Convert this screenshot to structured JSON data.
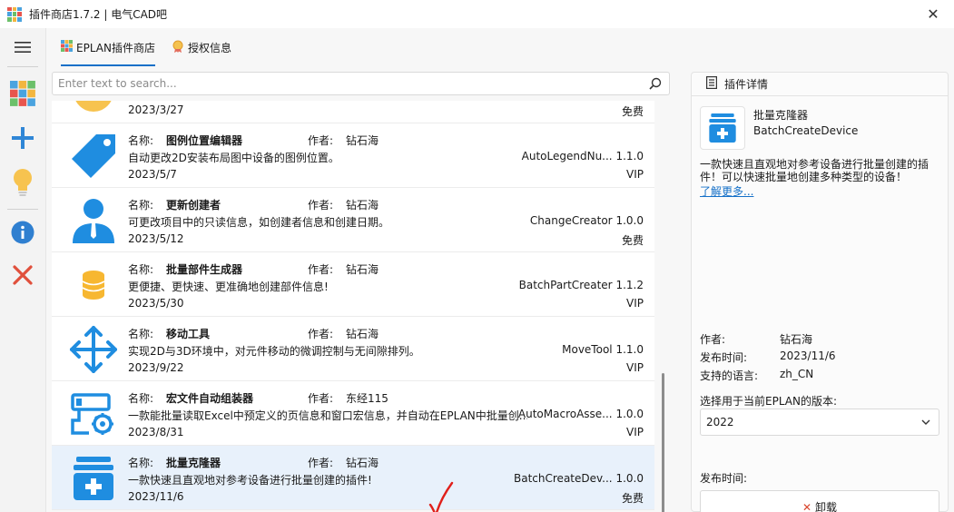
{
  "window": {
    "title": "插件商店1.7.2 | 电气CAD吧",
    "close_glyph": "✕",
    "icon_colors": [
      "#e8554e",
      "#f3b63f",
      "#4aa3df",
      "#4aa3df",
      "#6cc06a",
      "#e8554e",
      "#6cc06a",
      "#f3b63f",
      "#4aa3df"
    ]
  },
  "rail": {
    "items": [
      {
        "icon": "menu-icon"
      },
      {
        "icon": "store-icon"
      },
      {
        "icon": "add-icon"
      },
      {
        "icon": "lightbulb-icon"
      },
      {
        "icon": "info-icon"
      },
      {
        "icon": "close-icon"
      }
    ]
  },
  "tabs": [
    {
      "label": "EPLAN插件商店",
      "icon": "store-icon",
      "active": true
    },
    {
      "label": "授权信息",
      "icon": "license-icon",
      "active": false
    }
  ],
  "search": {
    "placeholder": "Enter text to search..."
  },
  "list": {
    "name_label": "名称:",
    "author_label": "作者:",
    "partial_row": {
      "date": "2023/3/27",
      "price": "免费"
    },
    "rows": [
      {
        "name": "图例位置编辑器",
        "author": "钻石海",
        "desc": "自动更改2D安装布局图中设备的图例位置。",
        "date": "2023/5/7",
        "cmd": "AutoLegendNu...",
        "version": "1.1.0",
        "price": "VIP",
        "icon": "tag-icon",
        "selected": false
      },
      {
        "name": "更新创建者",
        "author": "钻石海",
        "desc": "可更改项目中的只读信息，如创建者信息和创建日期。",
        "date": "2023/5/12",
        "cmd": "ChangeCreator",
        "version": "1.0.0",
        "price": "免费",
        "icon": "user-icon",
        "selected": false
      },
      {
        "name": "批量部件生成器",
        "author": "钻石海",
        "desc": "更便捷、更快速、更准确地创建部件信息!",
        "date": "2023/5/30",
        "cmd": "BatchPartCreater",
        "version": "1.1.2",
        "price": "VIP",
        "icon": "coins-icon",
        "selected": false
      },
      {
        "name": "移动工具",
        "author": "钻石海",
        "desc": "实现2D与3D环境中，对元件移动的微调控制与无间隙排列。",
        "date": "2023/9/22",
        "cmd": "MoveTool",
        "version": "1.1.0",
        "price": "VIP",
        "icon": "move-icon",
        "selected": false
      },
      {
        "name": "宏文件自动组装器",
        "author": "东经115",
        "desc": "一款能批量读取Excel中预定义的页信息和窗口宏信息，并自动在EPLAN中批量创...",
        "date": "2023/8/31",
        "cmd": "AutoMacroAsse...",
        "version": "1.0.0",
        "price": "VIP",
        "icon": "macro-gear-icon",
        "selected": false
      },
      {
        "name": "批量克隆器",
        "author": "钻石海",
        "desc": "一款快速且直观地对参考设备进行批量创建的插件!",
        "date": "2023/11/6",
        "cmd": "BatchCreateDev...",
        "version": "1.0.0",
        "price": "免费",
        "icon": "clone-icon",
        "selected": true
      }
    ]
  },
  "detail": {
    "header": "插件详情",
    "name": "批量克隆器",
    "command": "BatchCreateDevice",
    "description": "一款快速且直观地对参考设备进行批量创建的插件！可以快速批量地创建多种类型的设备！",
    "more_link": "了解更多...",
    "author_label": "作者:",
    "author": "钻石海",
    "release_time_label": "发布时间:",
    "release_time": "2023/11/6",
    "language_label": "支持的语言:",
    "language": "zh_CN",
    "version_select_label": "选择用于当前EPLAN的版本:",
    "version_selected": "2022",
    "publish_time_label": "发布时间:",
    "uninstall_label": "卸载"
  },
  "colors": {
    "accent": "#1570c8",
    "icon_blue": "#1f8de0",
    "selected_row": "#e8f1fb",
    "danger": "#d9442b",
    "check_red": "#e0201b"
  }
}
